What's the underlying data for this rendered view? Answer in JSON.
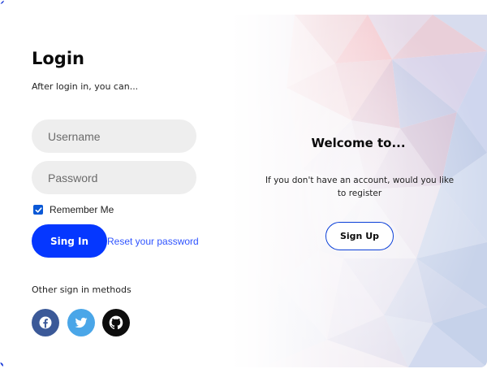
{
  "login": {
    "title": "Login",
    "subtitle": "After login in, you can...",
    "username_placeholder": "Username",
    "password_placeholder": "Password",
    "remember_label": "Remember Me",
    "remember_checked": true,
    "signin_label": "Sing In",
    "reset_label": "Reset your password",
    "other_methods_label": "Other sign in methods",
    "social": [
      {
        "icon": "facebook-icon",
        "color": "#3b5998"
      },
      {
        "icon": "twitter-icon",
        "color": "#4aa6e8"
      },
      {
        "icon": "github-icon",
        "color": "#0d0d0d"
      }
    ],
    "accent_color": "#0537ff"
  },
  "register": {
    "welcome": "Welcome to...",
    "description": "If you don't have an account, would you like to register",
    "signup_label": "Sign Up"
  }
}
